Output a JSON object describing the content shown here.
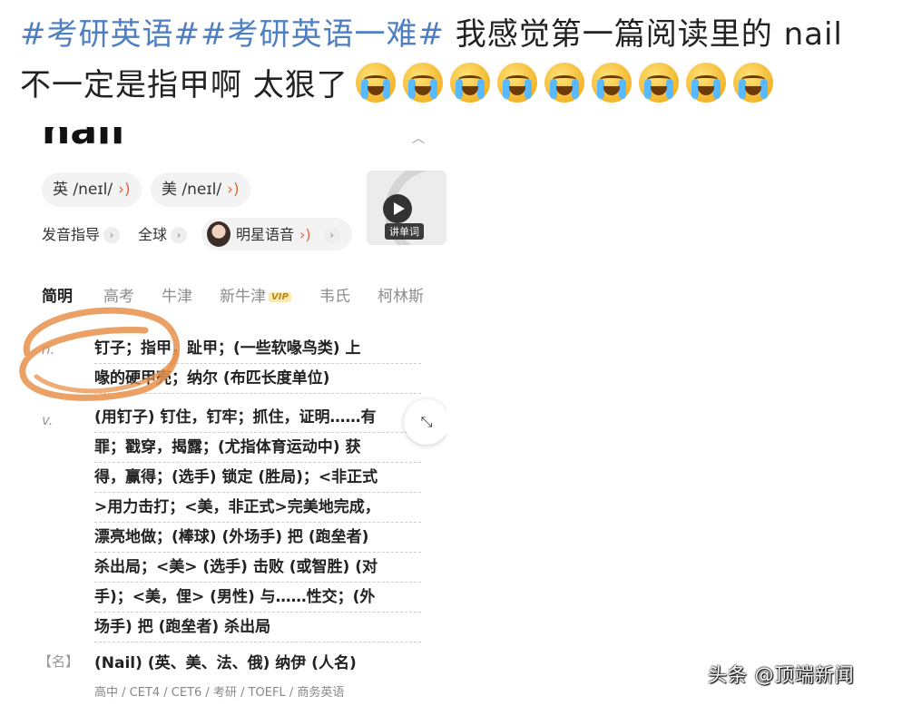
{
  "post": {
    "hashtag1": "#考研英语#",
    "hashtag2": "#考研英语一难#",
    "text_line1": " 我感觉第一篇阅读里的 nail",
    "text_line2": "不一定是指甲啊 太狠了",
    "emoji_name": "crying-face-icon",
    "emoji_count": 9
  },
  "dictionary": {
    "word": "nail",
    "pron_uk_label": "英",
    "pron_uk": "/neɪl/",
    "pron_us_label": "美",
    "pron_us": "/neɪl/",
    "guide_label": "发音指导",
    "global_label": "全球",
    "star_voice_label": "明星语音",
    "video_label": "讲单词",
    "tabs": [
      "简明",
      "高考",
      "牛津",
      "新牛津",
      "韦氏",
      "柯林斯"
    ],
    "vip_badge": "VIP",
    "noun_pos": "n.",
    "noun_def_lines": [
      "钉子；指甲，趾甲；(一些软喙鸟类) 上",
      "喙的硬甲壳；纳尔 (布匹长度单位)"
    ],
    "verb_pos": "v.",
    "verb_def_lines": [
      "(用钉子) 钉住，钉牢；抓住，证明……有",
      "罪；戳穿，揭露；(尤指体育运动中) 获",
      "得，赢得；(选手) 锁定 (胜局)；<非正式",
      ">用力击打；<美，非正式>完美地完成，",
      "漂亮地做；(棒球) (外场手) 把 (跑垒者)",
      "杀出局；<美> (选手) 击败 (或智胜) (对",
      "手)；<美，俚> (男性) 与……性交；(外",
      "场手) 把 (跑垒者) 杀出局"
    ],
    "name_pos": "【名】",
    "name_def": "(Nail) (英、美、法、俄) 纳伊 (人名)",
    "levels": "高中 / CET4 / CET6 / 考研 / TOEFL / 商务英语"
  },
  "watermark": "头条 @顶端新闻",
  "colors": {
    "hashtag": "#4d7fc2",
    "annotation_circle": "#e8904a",
    "speaker": "#e2653c"
  }
}
